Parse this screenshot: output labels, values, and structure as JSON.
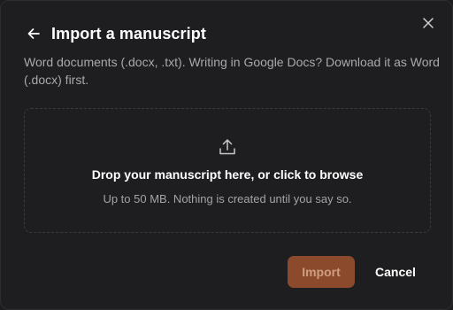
{
  "dialog": {
    "title": "Import a manuscript",
    "subtitle": "Word documents (.docx, .txt). Writing in Google Docs? Download it as Word (.docx) first.",
    "back_icon": "arrow-left-icon",
    "close_icon": "close-icon"
  },
  "dropzone": {
    "icon": "upload-icon",
    "title": "Drop your manuscript here, or click to browse",
    "hint": "Up to 50 MB. Nothing is created until you say so."
  },
  "footer": {
    "import_label": "Import",
    "import_enabled": false,
    "cancel_label": "Cancel"
  },
  "colors": {
    "background": "#1e1e20",
    "accent": "#8a4a2b",
    "muted_text": "#a9a9ae"
  }
}
